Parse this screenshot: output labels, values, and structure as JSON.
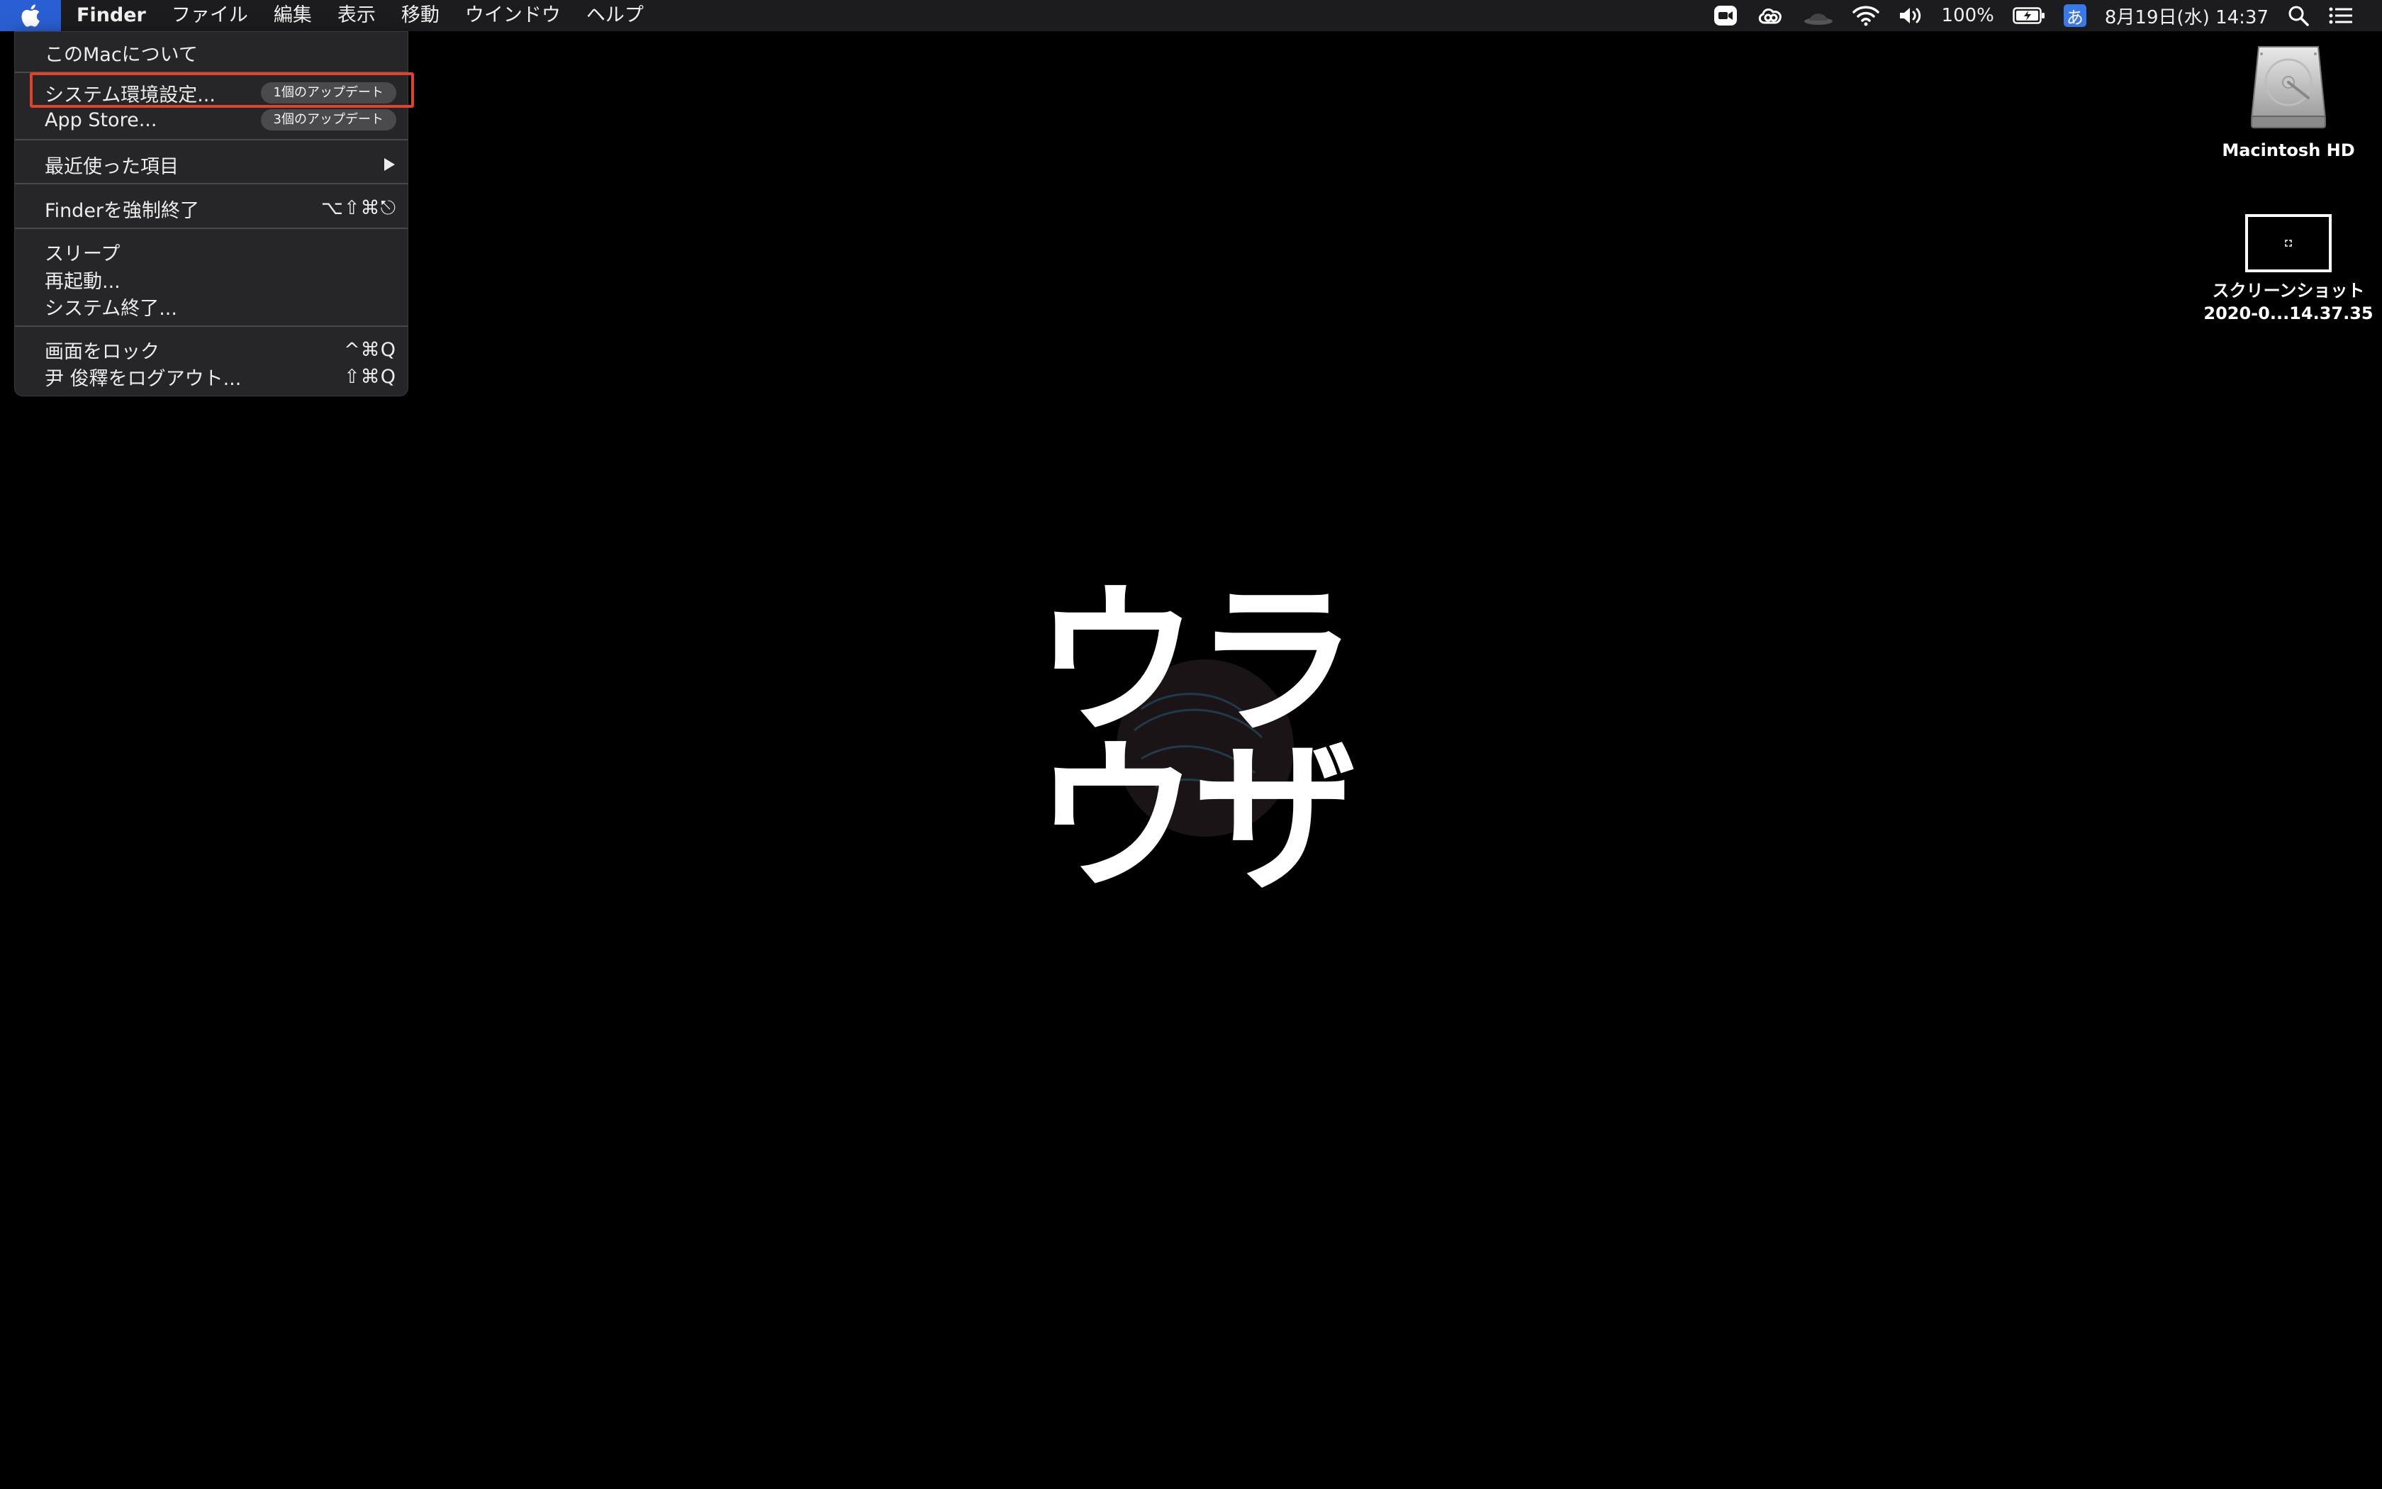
{
  "menubar": {
    "app_name": "Finder",
    "menus": [
      "ファイル",
      "編集",
      "表示",
      "移動",
      "ウインドウ",
      "ヘルプ"
    ],
    "status": {
      "battery_percent": "100%",
      "ime_label": "あ",
      "datetime": "8月19日(水) 14:37"
    },
    "icons": [
      "zoom-icon",
      "creative-cloud-icon",
      "hat-icon",
      "wifi-icon",
      "volume-icon",
      "battery-icon",
      "search-icon",
      "control-list-icon"
    ]
  },
  "apple_menu": {
    "items": {
      "about": "このMacについて",
      "system_prefs": "システム環境設定...",
      "system_prefs_badge": "1個のアップデート",
      "app_store": "App Store...",
      "app_store_badge": "3個のアップデート",
      "recent": "最近使った項目",
      "force_quit": "Finderを強制終了",
      "force_quit_shortcut": "⌥⇧⌘⎋",
      "sleep": "スリープ",
      "restart": "再起動...",
      "shutdown": "システム終了...",
      "lock": "画面をロック",
      "lock_shortcut": "^⌘Q",
      "logout": "尹 俊釋をログアウト...",
      "logout_shortcut": "⇧⌘Q"
    }
  },
  "desktop": {
    "hd_label": "Macintosh HD",
    "screenshot_label_line1": "スクリーンショット",
    "screenshot_label_line2": "2020-0...14.37.35"
  },
  "wallpaper": {
    "chars": [
      "ウ",
      "ラ",
      "ウ",
      "ザ"
    ]
  },
  "colors": {
    "accent_blue": "#2a5fd3",
    "highlight_red": "#e0432c",
    "menu_bg": "#262628",
    "menubar_bg": "#1c1c1e"
  }
}
